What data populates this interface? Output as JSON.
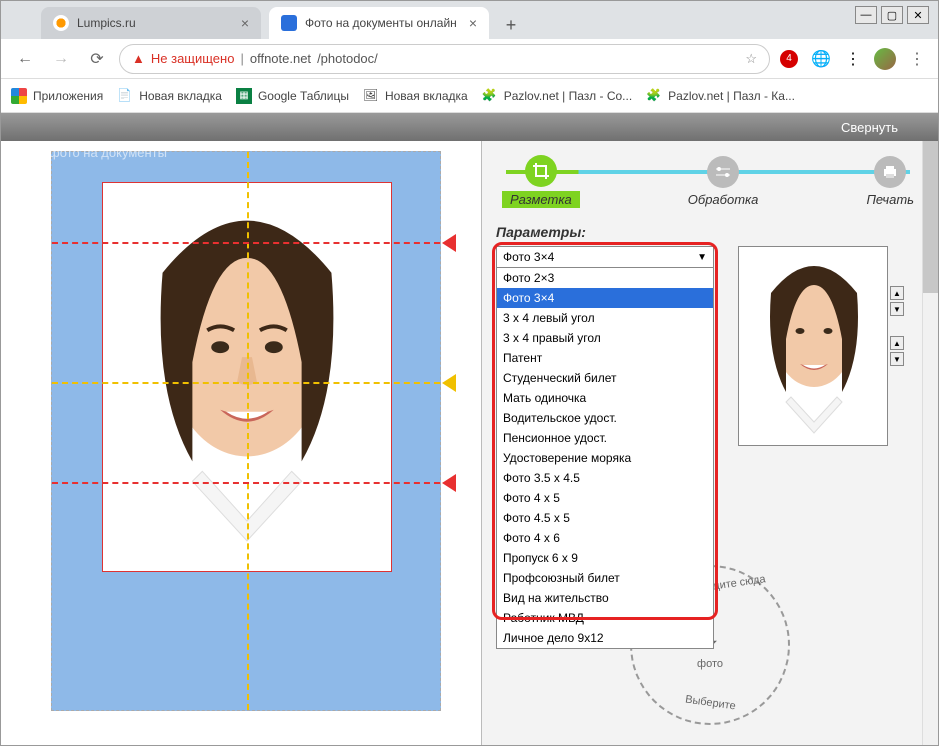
{
  "window": {
    "minimize": "—",
    "maximize": "▢",
    "close": "✕"
  },
  "tabs": [
    {
      "title": "Lumpics.ru",
      "favicon_color": "#f90"
    },
    {
      "title": "Фото на документы онлайн",
      "favicon_color": "#2a6fdb"
    }
  ],
  "new_tab": "+",
  "nav": {
    "back": "←",
    "forward": "→",
    "reload": "⟳"
  },
  "url": {
    "warn_icon": "▲",
    "warn_text": "Не защищено",
    "sep": "|",
    "host": "offnote.net",
    "path": "/photodoc/"
  },
  "right_icons": {
    "star": "☆",
    "badge": "4",
    "globe": "🌐",
    "menu": "⋮"
  },
  "bookmarks": [
    {
      "icon": "⋮⋮⋮",
      "label": "Приложения"
    },
    {
      "icon": "📄",
      "label": "Новая вкладка"
    },
    {
      "icon": "▦",
      "label": "Google Таблицы"
    },
    {
      "icon": "🖼",
      "label": "Новая вкладка"
    },
    {
      "icon": "🧩",
      "label": "Pazlov.net | Пазл - Со..."
    },
    {
      "icon": "🧩",
      "label": "Pazlov.net | Пазл - Ка..."
    }
  ],
  "collapse": "Свернуть",
  "watermark": "фото на документы",
  "steps": [
    {
      "label": "Разметка",
      "icon": "✂"
    },
    {
      "label": "Обработка",
      "icon": "⚙"
    },
    {
      "label": "Печать",
      "icon": "🖨"
    }
  ],
  "params_title": "Параметры:",
  "dropdown": {
    "selected": "Фото 3×4",
    "options": [
      "Фото 2×3",
      "Фото 3×4",
      "3 x 4 левый угол",
      "3 x 4 правый угол",
      "Патент",
      "Студенческий билет",
      "Мать одиночка",
      "Водительское удост.",
      "Пенсионное удост.",
      "Удостоверение моряка",
      "Фото 3.5 x 4.5",
      "Фото 4 x 5",
      "Фото 4.5 x 5",
      "Фото 4 x 6",
      "Пропуск 6 x 9",
      "Профсоюзный билет",
      "Вид на жительство",
      "Работник МВД",
      "Личное дело 9x12"
    ],
    "selected_index": 1
  },
  "dropzone": {
    "line1": "Выберите",
    "line2": "фото",
    "line3": "или перетащите сюда"
  }
}
